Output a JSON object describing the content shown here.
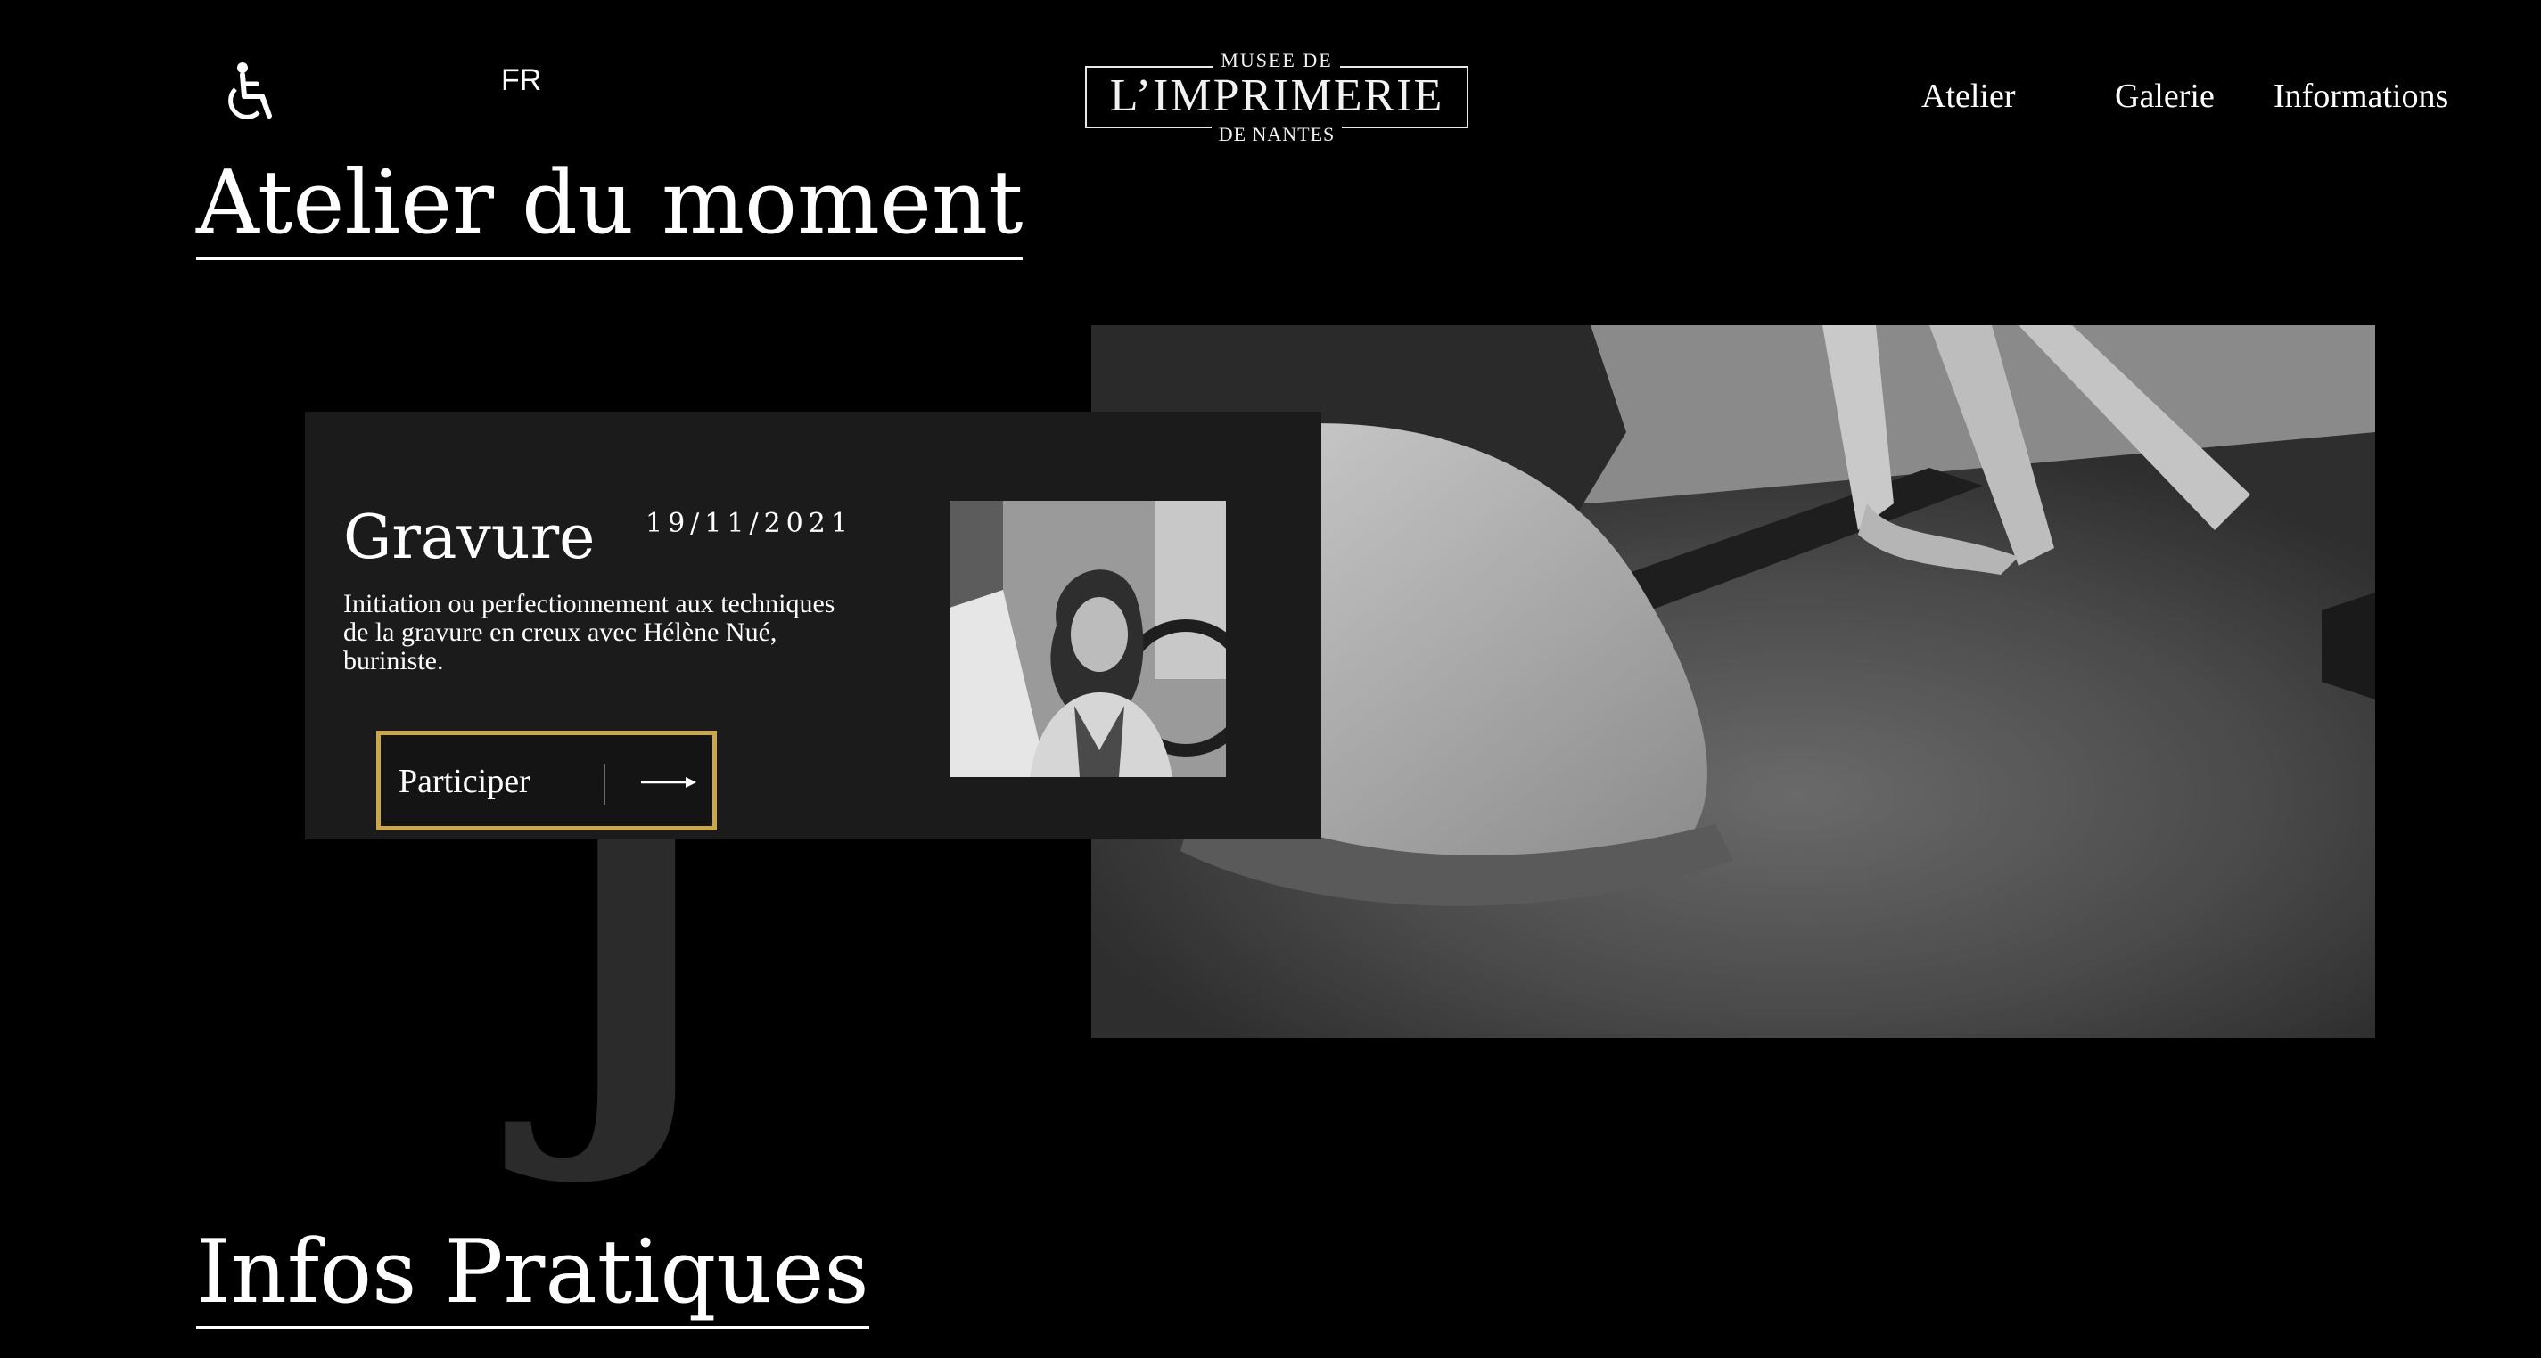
{
  "header": {
    "accessibility_icon": "wheelchair-icon",
    "language": "FR",
    "logo": {
      "top": "MUSEE DE",
      "main": "L’IMPRIMERIE",
      "bottom": "DE NANTES"
    },
    "nav": [
      "Atelier",
      "Galerie",
      "Informations"
    ]
  },
  "atelier_section": {
    "title": "Atelier du moment",
    "card": {
      "title": "Gravure",
      "date": "19/11/2021",
      "description": "Initiation ou perfectionnement aux techniques de la gravure en creux avec Hélène Nué, buriniste.",
      "button_label": "Participer",
      "button_icon": "arrow-right-icon"
    },
    "decorative_letter": "J"
  },
  "infos_section": {
    "title": "Infos Pratiques"
  },
  "colors": {
    "background": "#000000",
    "card_background": "#1b1b1b",
    "button_border": "#c8a84a",
    "decorative_letter": "#2b2b2b"
  }
}
